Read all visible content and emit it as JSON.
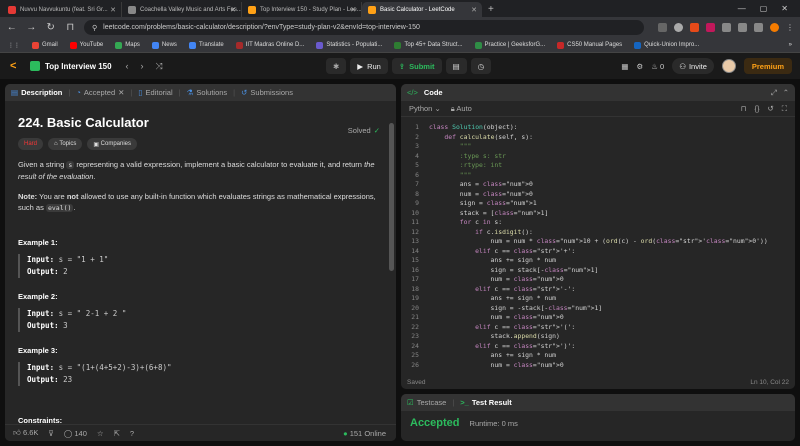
{
  "browser": {
    "tabs": [
      {
        "title": "Nuvvu Navvukuntu (feat. Sri Gr...",
        "color": "#e53935",
        "active": false
      },
      {
        "title": "Coachella Valley Music and Arts Fes...",
        "color": "#888888",
        "active": false
      },
      {
        "title": "Top Interview 150 - Study Plan - Lee...",
        "color": "#ffa116",
        "active": false
      },
      {
        "title": "Basic Calculator - LeetCode",
        "color": "#ffa116",
        "active": true
      }
    ],
    "new_tab_label": "+",
    "url": "leetcode.com/problems/basic-calculator/description/?envType=study-plan-v2&envId=top-interview-150",
    "bookmarks": [
      "Gmail",
      "YouTube",
      "Maps",
      "News",
      "Translate",
      "IIT Madras Online D...",
      "Statistics - Populati...",
      "Top 45+ Data Struct...",
      "Practice | GeeksforG...",
      "CS50 Manual Pages",
      "Quick-Union Impro..."
    ],
    "bookmark_colors": [
      "#ea4335",
      "#ff0000",
      "#34a853",
      "#4285f4",
      "#4285f4",
      "#a52a2a",
      "#6a5acd",
      "#2e7d32",
      "#2f8d46",
      "#c62828",
      "#1565c0"
    ]
  },
  "leetcode_nav": {
    "study_plan_title": "Top Interview 150",
    "run_label": "Run",
    "submit_label": "Submit",
    "streak_count": "0",
    "invite_label": "Invite",
    "premium_label": "Premium"
  },
  "description_panel": {
    "tabs": [
      "Description",
      "Accepted",
      "Editorial",
      "Solutions",
      "Submissions"
    ],
    "problem_title": "224. Basic Calculator",
    "solved_label": "Solved",
    "difficulty": "Hard",
    "tag_topics": "Topics",
    "tag_companies": "Companies",
    "statement_1": "Given a string",
    "statement_var": "s",
    "statement_2": "representing a valid expression, implement a basic calculator to evaluate it, and return",
    "statement_em": "the result of the evaluation",
    "statement_end": ".",
    "note_label": "Note:",
    "note_1": "You are",
    "note_not": "not",
    "note_2": "allowed to use any built-in function which evaluates strings as mathematical expressions, such as",
    "note_code": "eval()",
    "note_end": ".",
    "examples": [
      {
        "heading": "Example 1:",
        "input": "s = \"1 + 1\"",
        "output": "2"
      },
      {
        "heading": "Example 2:",
        "input": "s = \" 2-1 + 2 \"",
        "output": "3"
      },
      {
        "heading": "Example 3:",
        "input": "s = \"(1+(4+5+2)-3)+(6+8)\"",
        "output": "23"
      }
    ],
    "input_label": "Input:",
    "output_label": "Output:",
    "constraints_heading": "Constraints:",
    "likes": "6.6K",
    "comments": "140",
    "online": "151 Online"
  },
  "code_panel": {
    "header_label": "Code",
    "language": "Python",
    "autosave": "Auto",
    "status_saved": "Saved",
    "cursor_position": "Ln 10, Col 22",
    "lines": [
      "class Solution(object):",
      "    def calculate(self, s):",
      "        \"\"\"",
      "        :type s: str",
      "        :rtype: int",
      "        \"\"\"",
      "        ans = 0",
      "        num = 0",
      "        sign = 1",
      "        stack = [1]",
      "        for c in s:",
      "            if c.isdigit():",
      "                num = num * 10 + (ord(c) - ord('0'))",
      "            elif c == '+':",
      "                ans += sign * num",
      "                sign = stack[-1]",
      "                num = 0",
      "            elif c == '-':",
      "                ans += sign * num",
      "                sign = -stack[-1]",
      "                num = 0",
      "            elif c == '(':",
      "                stack.append(sign)",
      "            elif c == ')':",
      "                ans += sign * num",
      "                num = 0"
    ]
  },
  "result_panel": {
    "tab_testcase": "Testcase",
    "tab_result": "Test Result",
    "verdict": "Accepted",
    "runtime": "Runtime: 0 ms"
  },
  "colors": {
    "accent": "#ffa116",
    "success": "#2cbb5d",
    "hard": "#f63737"
  }
}
